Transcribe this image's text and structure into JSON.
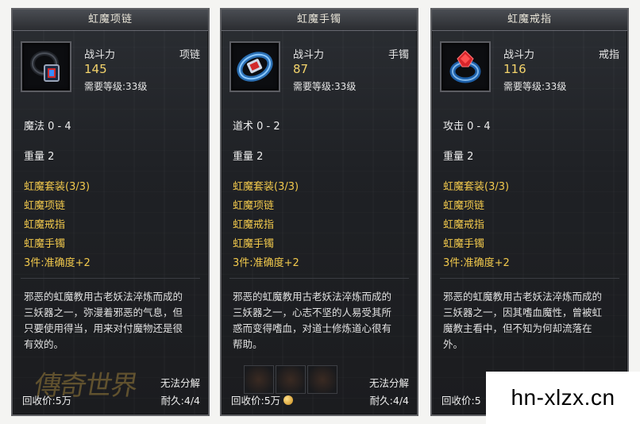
{
  "common": {
    "combat_label": "战斗力",
    "set_title": "虹魔套装(3/3)",
    "set_items": [
      "虹魔项链",
      "虹魔戒指",
      "虹魔手镯"
    ],
    "set_bonus": "3件:准确度+2",
    "weight": "重量 2",
    "no_decompose": "无法分解",
    "durability": "耐久:4/4"
  },
  "panels": [
    {
      "title": "虹魔项链",
      "slot": "项链",
      "combat_power": "145",
      "required_level": "需要等级:33级",
      "stat": "魔法 0 - 4",
      "desc": [
        "邪恶的虹魔教用古老妖法淬炼而成的",
        "三妖器之一，弥漫着邪恶的气息，但",
        "只要使用得当，用来对付魔物还是很",
        "有效的。"
      ],
      "recycle": "回收价:5万",
      "icon": "necklace-icon",
      "logo": "傳奇世界"
    },
    {
      "title": "虹魔手镯",
      "slot": "手镯",
      "combat_power": "87",
      "required_level": "需要等级:33级",
      "stat": "道术 0 - 2",
      "desc": [
        "邪恶的虹魔教用古老妖法淬炼而成的",
        "三妖器之一，心志不坚的人易受其所",
        "惑而变得嗜血，对道士修炼道心很有",
        "帮助。"
      ],
      "recycle": "回收价:5万",
      "icon": "bracelet-icon"
    },
    {
      "title": "虹魔戒指",
      "slot": "戒指",
      "combat_power": "116",
      "required_level": "需要等级:33级",
      "stat": "攻击 0 - 4",
      "desc": [
        "邪恶的虹魔教用古老妖法淬炼而成的",
        "三妖器之一，因其嗜血魔性，曾被虹",
        "魔教主看中，但不知为何却流落在",
        "外。"
      ],
      "recycle": "回收价:5",
      "icon": "ring-icon"
    }
  ],
  "watermark": "hn-xlzx.cn"
}
